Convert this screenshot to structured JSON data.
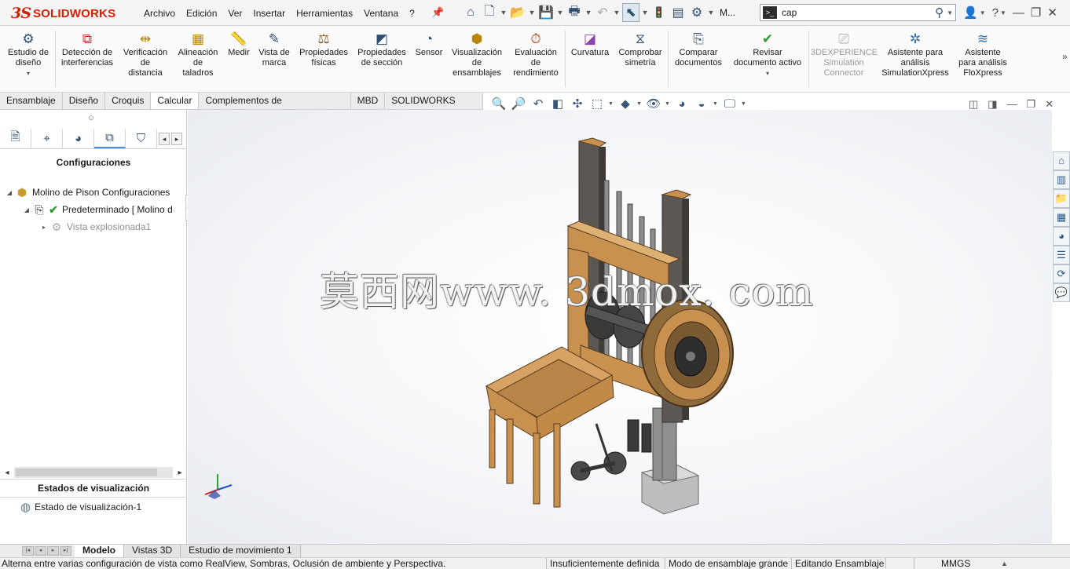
{
  "app": {
    "logo_ds": "3S",
    "logo_text": "SOLIDWORKS"
  },
  "menu": [
    "Archivo",
    "Edición",
    "Ver",
    "Insertar",
    "Herramientas",
    "Ventana",
    "?"
  ],
  "menu_more": "M...",
  "search": {
    "value": "cap",
    "icon": "search-icon"
  },
  "ribbon": {
    "items": [
      {
        "label": "Estudio de\ndiseño",
        "icon": "design-study-icon"
      },
      {
        "label": "Detección de\ninterferencias",
        "icon": "interference-icon"
      },
      {
        "label": "Verificación\nde\ndistancia",
        "icon": "clearance-icon"
      },
      {
        "label": "Alineación\nde\ntaladros",
        "icon": "hole-align-icon"
      },
      {
        "label": "Medir",
        "icon": "measure-icon"
      },
      {
        "label": "Vista de\nmarca",
        "icon": "markup-icon"
      },
      {
        "label": "Propiedades\nfísicas",
        "icon": "mass-properties-icon"
      },
      {
        "label": "Propiedades\nde sección",
        "icon": "section-properties-icon"
      },
      {
        "label": "Sensor",
        "icon": "sensor-icon"
      },
      {
        "label": "Visualización\nde\nensamblajes",
        "icon": "assembly-visualization-icon"
      },
      {
        "label": "Evaluación\nde\nrendimiento",
        "icon": "performance-icon"
      },
      {
        "label": "Curvatura",
        "icon": "curvature-icon"
      },
      {
        "label": "Comprobar\nsimetría",
        "icon": "symmetry-icon"
      },
      {
        "label": "Comparar\ndocumentos",
        "icon": "compare-icon"
      },
      {
        "label": "Revisar\ndocumento activo",
        "icon": "review-icon"
      },
      {
        "label": "3DEXPERIENCE\nSimulation\nConnector",
        "icon": "3dx-icon"
      },
      {
        "label": "Asistente para\nanálisis\nSimulationXpress",
        "icon": "simxpress-icon"
      },
      {
        "label": "Asistente\npara análisis\nFloXpress",
        "icon": "floxpress-icon"
      }
    ]
  },
  "cm_tabs": [
    "Ensamblaje",
    "Diseño",
    "Croquis",
    "Calcular",
    "Complementos de SOLIDWORKS",
    "MBD",
    "SOLIDWORKS CAM"
  ],
  "cm_active_tab": "Calcular",
  "left_panel": {
    "heading": "Configuraciones",
    "tree": [
      {
        "label": "Molino de Pison Configuraciones",
        "icon": "assembly-icon"
      },
      {
        "label": "Predeterminado [ Molino d",
        "icon": "configuration-icon"
      },
      {
        "label": "Vista explosionada1",
        "icon": "exploded-view-icon"
      }
    ],
    "display_states_heading": "Estados de visualización",
    "display_state": "Estado de visualización-1"
  },
  "watermark": "莫西网www. 3dmox. com",
  "bottom_tabs": [
    "Modelo",
    "Vistas 3D",
    "Estudio de movimiento 1"
  ],
  "bottom_active_tab": "Modelo",
  "status": {
    "message": "Alterna entre varias configuración de vista como RealView, Sombras, Oclusión de ambiente y Perspectiva.",
    "definition": "Insuficientemente definida",
    "mode": "Modo de ensamblaje grande",
    "editing": "Editando Ensamblaje",
    "units": "MMGS"
  },
  "colors": {
    "brand_red": "#d81e05",
    "wood": "#c9914f",
    "metal_dark": "#3a3a3a",
    "accent_blue": "#4a8fd6"
  }
}
